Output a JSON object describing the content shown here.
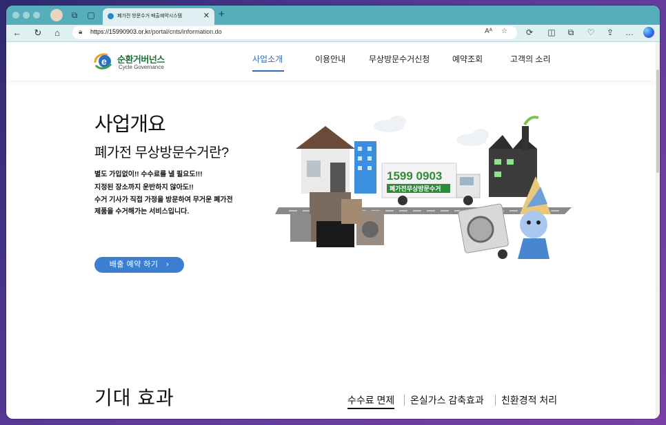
{
  "browser": {
    "tab_title": "폐가전 방문수거 배출예약시스템",
    "url_host": "https://15990903.or.kr",
    "url_path": "/portal/cnts/information.do",
    "read_aloud": "Aᴬ"
  },
  "header": {
    "logo_kr": "순환거버넌스",
    "logo_en": "Cycle Governance",
    "menu": [
      {
        "label": "사업소개",
        "active": true
      },
      {
        "label": "이용안내"
      },
      {
        "label": "무상방문수거신청"
      },
      {
        "label": "예약조회"
      },
      {
        "label": "고객의 소리"
      }
    ]
  },
  "intro": {
    "title": "사업개요",
    "subtitle": "폐가전 무상방문수거란?",
    "lines": [
      "별도 가입없이!! 수수료를 낼 필요도!!!",
      "지정된 장소까지 운반하지 않아도!!",
      "수거 기사가 직접 가정을 방문하여 무거운 폐가전",
      "제품을 수거해가는 서비스입니다."
    ],
    "cta_label": "배출 예약 하기"
  },
  "illustration": {
    "truck_phone": "1599 0903",
    "truck_text": "폐가전무상방문수거"
  },
  "effects": {
    "title": "기대 효과",
    "items": [
      "수수료 면제",
      "온실가스 감축효과",
      "친환경적 처리"
    ]
  },
  "colors": {
    "accent": "#2d6ab8",
    "button": "#3c7fd0",
    "tabstrip": "#56aebd",
    "logo_green": "#1d6e3a"
  }
}
